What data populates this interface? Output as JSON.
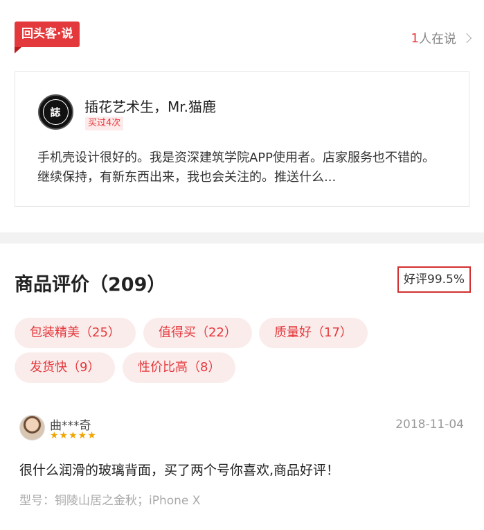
{
  "section_tag": "回头客·说",
  "say_count": {
    "num": "1",
    "suffix": "人在说"
  },
  "featured_review": {
    "avatar_text": "誌",
    "user": "插花艺术生，Mr.猫鹿",
    "badge": "买过4次",
    "text": "手机壳设计很好的。我是资深建筑学院APP使用者。店家服务也不错的。继续保持，有新东西出来，我也会关注的。推送什么..."
  },
  "reviews": {
    "title": "商品评价（209）",
    "good_rate": "好评99.5%",
    "tags": [
      "包装精美（25）",
      "值得买（22）",
      "质量好（17）",
      "发货快（9）",
      "性价比高（8）"
    ],
    "items": [
      {
        "user": "曲***奇",
        "stars": "★★★★★",
        "rating": 5,
        "date": "2018-11-04",
        "text": "很什么润滑的玻璃背面，买了两个号你喜欢,商品好评！",
        "model": "型号：铜陵山居之金秋；iPhone X"
      }
    ]
  },
  "colors": {
    "accent": "#e4393c",
    "chip_bg": "#fbecec",
    "star": "#f0a500"
  }
}
